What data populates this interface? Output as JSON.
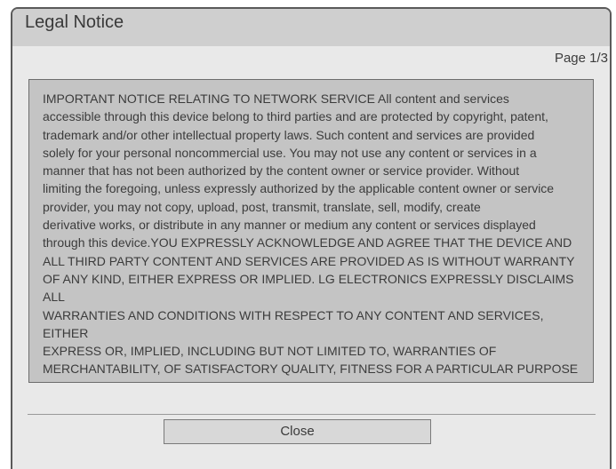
{
  "dialog": {
    "title": "Legal Notice",
    "page_indicator": "Page 1/3",
    "notice_text": "IMPORTANT NOTICE RELATING TO NETWORK SERVICE All content and services\naccessible through this device belong to third parties and are protected by copyright, patent,\ntrademark and/or other intellectual property laws. Such content and services are provided\nsolely for your personal noncommercial use. You may not use any content or services in a\nmanner that has not been authorized by the content owner or service provider. Without\nlimiting the foregoing, unless expressly authorized by the applicable content owner or service\nprovider, you may not copy, upload, post, transmit, translate, sell, modify, create\nderivative works, or distribute in any manner or medium any content or services displayed\nthrough this device.YOU EXPRESSLY ACKNOWLEDGE AND AGREE THAT THE DEVICE AND\nALL THIRD PARTY CONTENT AND SERVICES ARE PROVIDED AS IS WITHOUT WARRANTY\nOF ANY KIND, EITHER EXPRESS OR IMPLIED. LG ELECTRONICS EXPRESSLY DISCLAIMS ALL\nWARRANTIES AND CONDITIONS WITH RESPECT TO ANY CONTENT AND SERVICES, EITHER\nEXPRESS OR, IMPLIED, INCLUDING BUT NOT LIMITED TO, WARRANTIES OF\nMERCHANTABILITY, OF SATISFACTORY QUALITY, FITNESS FOR A PARTICULAR PURPOSE",
    "close_label": "Close"
  }
}
